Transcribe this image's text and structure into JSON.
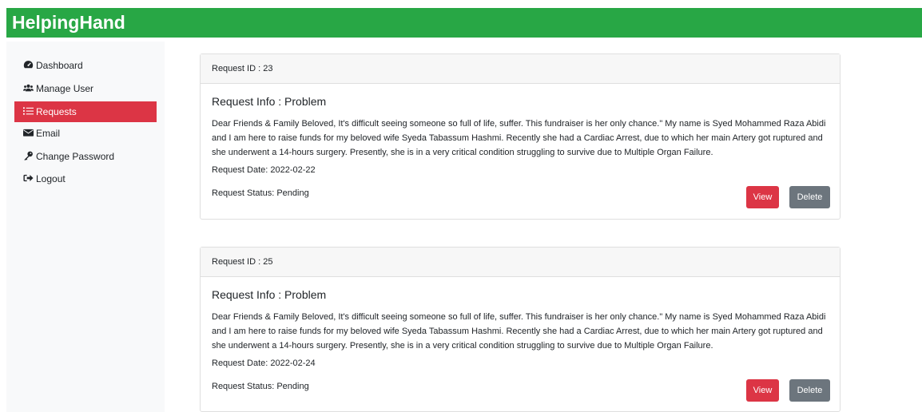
{
  "app": {
    "title": "HelpingHand"
  },
  "sidebar": {
    "items": [
      {
        "label": "Dashboard",
        "icon": "dashboard-icon"
      },
      {
        "label": "Manage User",
        "icon": "users-icon"
      },
      {
        "label": "Requests",
        "icon": "list-icon",
        "active": true
      },
      {
        "label": "Email",
        "icon": "envelope-icon"
      },
      {
        "label": "Change Password",
        "icon": "key-icon"
      },
      {
        "label": "Logout",
        "icon": "logout-icon"
      }
    ]
  },
  "colors": {
    "brand": "#28a745",
    "active": "#dc3545",
    "view_button": "#dc3545",
    "delete_button": "#6c757d"
  },
  "requests": [
    {
      "id_label": "Request ID : 23",
      "title": "Request Info : Problem",
      "description": "Dear Friends & Family Beloved, It's difficult seeing someone so full of life, suffer. This fundraiser is her only chance.\" My name is Syed Mohammed Raza Abidi and I am here to raise funds for my beloved wife Syeda Tabassum Hashmi. Recently she had a Cardiac Arrest, due to which her main Artery got ruptured and she underwent a 14-hours surgery. Presently, she is in a very critical condition struggling to survive due to Multiple Organ Failure.",
      "date": "Request Date: 2022-02-22",
      "status": "Request Status: Pending",
      "view_label": "View",
      "delete_label": "Delete"
    },
    {
      "id_label": "Request ID : 25",
      "title": "Request Info : Problem",
      "description": "Dear Friends & Family Beloved, It's difficult seeing someone so full of life, suffer. This fundraiser is her only chance.\" My name is Syed Mohammed Raza Abidi and I am here to raise funds for my beloved wife Syeda Tabassum Hashmi. Recently she had a Cardiac Arrest, due to which her main Artery got ruptured and she underwent a 14-hours surgery. Presently, she is in a very critical condition struggling to survive due to Multiple Organ Failure.",
      "date": "Request Date: 2022-02-24",
      "status": "Request Status: Pending",
      "view_label": "View",
      "delete_label": "Delete"
    }
  ]
}
